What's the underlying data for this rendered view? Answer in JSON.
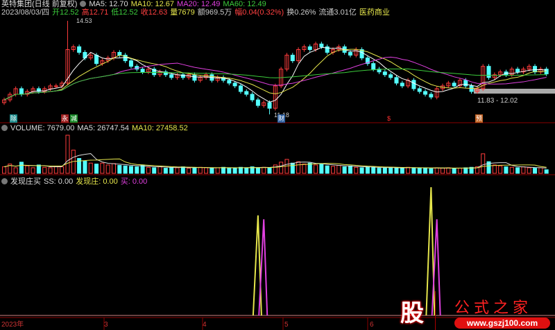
{
  "header": {
    "title": "英特集团(日线 前复权)",
    "ma5": "MA5: 12.70",
    "ma10": "MA10: 12.67",
    "ma20": "MA20: 12.49",
    "ma60": "MA60: 12.49",
    "date": "2023/08/03/四",
    "open": "开12.52",
    "high": "高12.71",
    "low": "低12.52",
    "close": "收12.63",
    "vol": "量7679",
    "amount": "额969.5万",
    "change": "幅0.04(0.32%)",
    "turnover": "换0.26%",
    "float": "流通3.01亿",
    "sector": "医药商业"
  },
  "annotations": {
    "max": "14.53",
    "min": "11.18",
    "range": "11.83 - 12.02"
  },
  "markers": [
    "除",
    "永",
    "减",
    "财",
    "$",
    "预"
  ],
  "volume_header": {
    "label": "VOLUME: 7679.00",
    "ma5": "MA5: 26747.54",
    "ma10": "MA10: 27458.52"
  },
  "indicator_header": {
    "name": "发现庄买",
    "ss": "SS: 0.00",
    "fx": "发现庄: 0.00",
    "buy": "买: 0.00"
  },
  "axis": {
    "labels": [
      "2023年",
      "3",
      "4",
      "5",
      "6"
    ]
  },
  "logo": {
    "char": "股",
    "text": "公式之家",
    "url": "www.gszj100.com"
  },
  "colors": {
    "up": "#ff3c3c",
    "down": "#54ffff",
    "ma5": "#ffffff",
    "ma10": "#e6e64c",
    "ma20": "#e040e0",
    "ma60": "#3ccc3c"
  },
  "chart_data": {
    "type": "candlestick",
    "closes": [
      11.7,
      11.9,
      12.1,
      11.9,
      12.0,
      12.1,
      12.0,
      12.1,
      12.2,
      12.2,
      12.3,
      13.5,
      13.6,
      13.4,
      13.2,
      13.3,
      13.0,
      13.1,
      13.2,
      13.4,
      13.3,
      13.1,
      12.9,
      12.8,
      12.7,
      12.8,
      12.6,
      12.7,
      12.6,
      12.5,
      12.6,
      12.5,
      12.6,
      12.4,
      12.5,
      12.6,
      12.4,
      12.5,
      12.4,
      12.3,
      12.2,
      12.0,
      11.9,
      11.7,
      11.5,
      11.6,
      11.4,
      12.2,
      12.8,
      13.3,
      13.1,
      13.5,
      13.6,
      13.5,
      13.7,
      13.6,
      13.4,
      13.5,
      13.6,
      13.4,
      13.3,
      13.5,
      13.2,
      13.0,
      12.8,
      12.7,
      12.6,
      12.5,
      12.3,
      12.2,
      12.4,
      12.1,
      12.0,
      11.9,
      11.8,
      12.1,
      12.2,
      12.3,
      12.2,
      12.4,
      12.2,
      12.0,
      12.1,
      12.9,
      12.5,
      12.6,
      12.7,
      12.6,
      12.8,
      12.7,
      12.8,
      12.9,
      12.7,
      12.8,
      12.63
    ],
    "volumes": [
      14000,
      20000,
      12000,
      24000,
      16000,
      12000,
      18000,
      13000,
      12000,
      15000,
      14000,
      82000,
      50000,
      32000,
      26000,
      22000,
      20000,
      22000,
      18000,
      21000,
      17000,
      16000,
      15000,
      14000,
      18000,
      13000,
      12000,
      14000,
      11000,
      13000,
      12000,
      14000,
      11000,
      12000,
      13000,
      12000,
      11000,
      12000,
      13000,
      12000,
      11000,
      13000,
      12000,
      14000,
      12000,
      13000,
      12000,
      18000,
      24000,
      30000,
      22000,
      25000,
      20000,
      22000,
      18000,
      20000,
      16000,
      15000,
      17000,
      14000,
      16000,
      13000,
      12000,
      14000,
      13000,
      11000,
      12000,
      13000,
      12000,
      11000,
      13000,
      12000,
      11000,
      12000,
      10000,
      12000,
      11000,
      12000,
      10000,
      11000,
      12000,
      13000,
      14000,
      42000,
      25000,
      18000,
      16000,
      14000,
      13000,
      12000,
      14000,
      12000,
      11000,
      12000,
      7679
    ],
    "signals": [
      {
        "bar": 44,
        "series": "发现庄",
        "value": 78
      },
      {
        "bar": 45,
        "series": "买",
        "value": 75
      },
      {
        "bar": 74,
        "series": "发现庄",
        "value": 100
      },
      {
        "bar": 75,
        "series": "买",
        "value": 75
      }
    ],
    "price_range": [
      10.9,
      14.8
    ]
  }
}
